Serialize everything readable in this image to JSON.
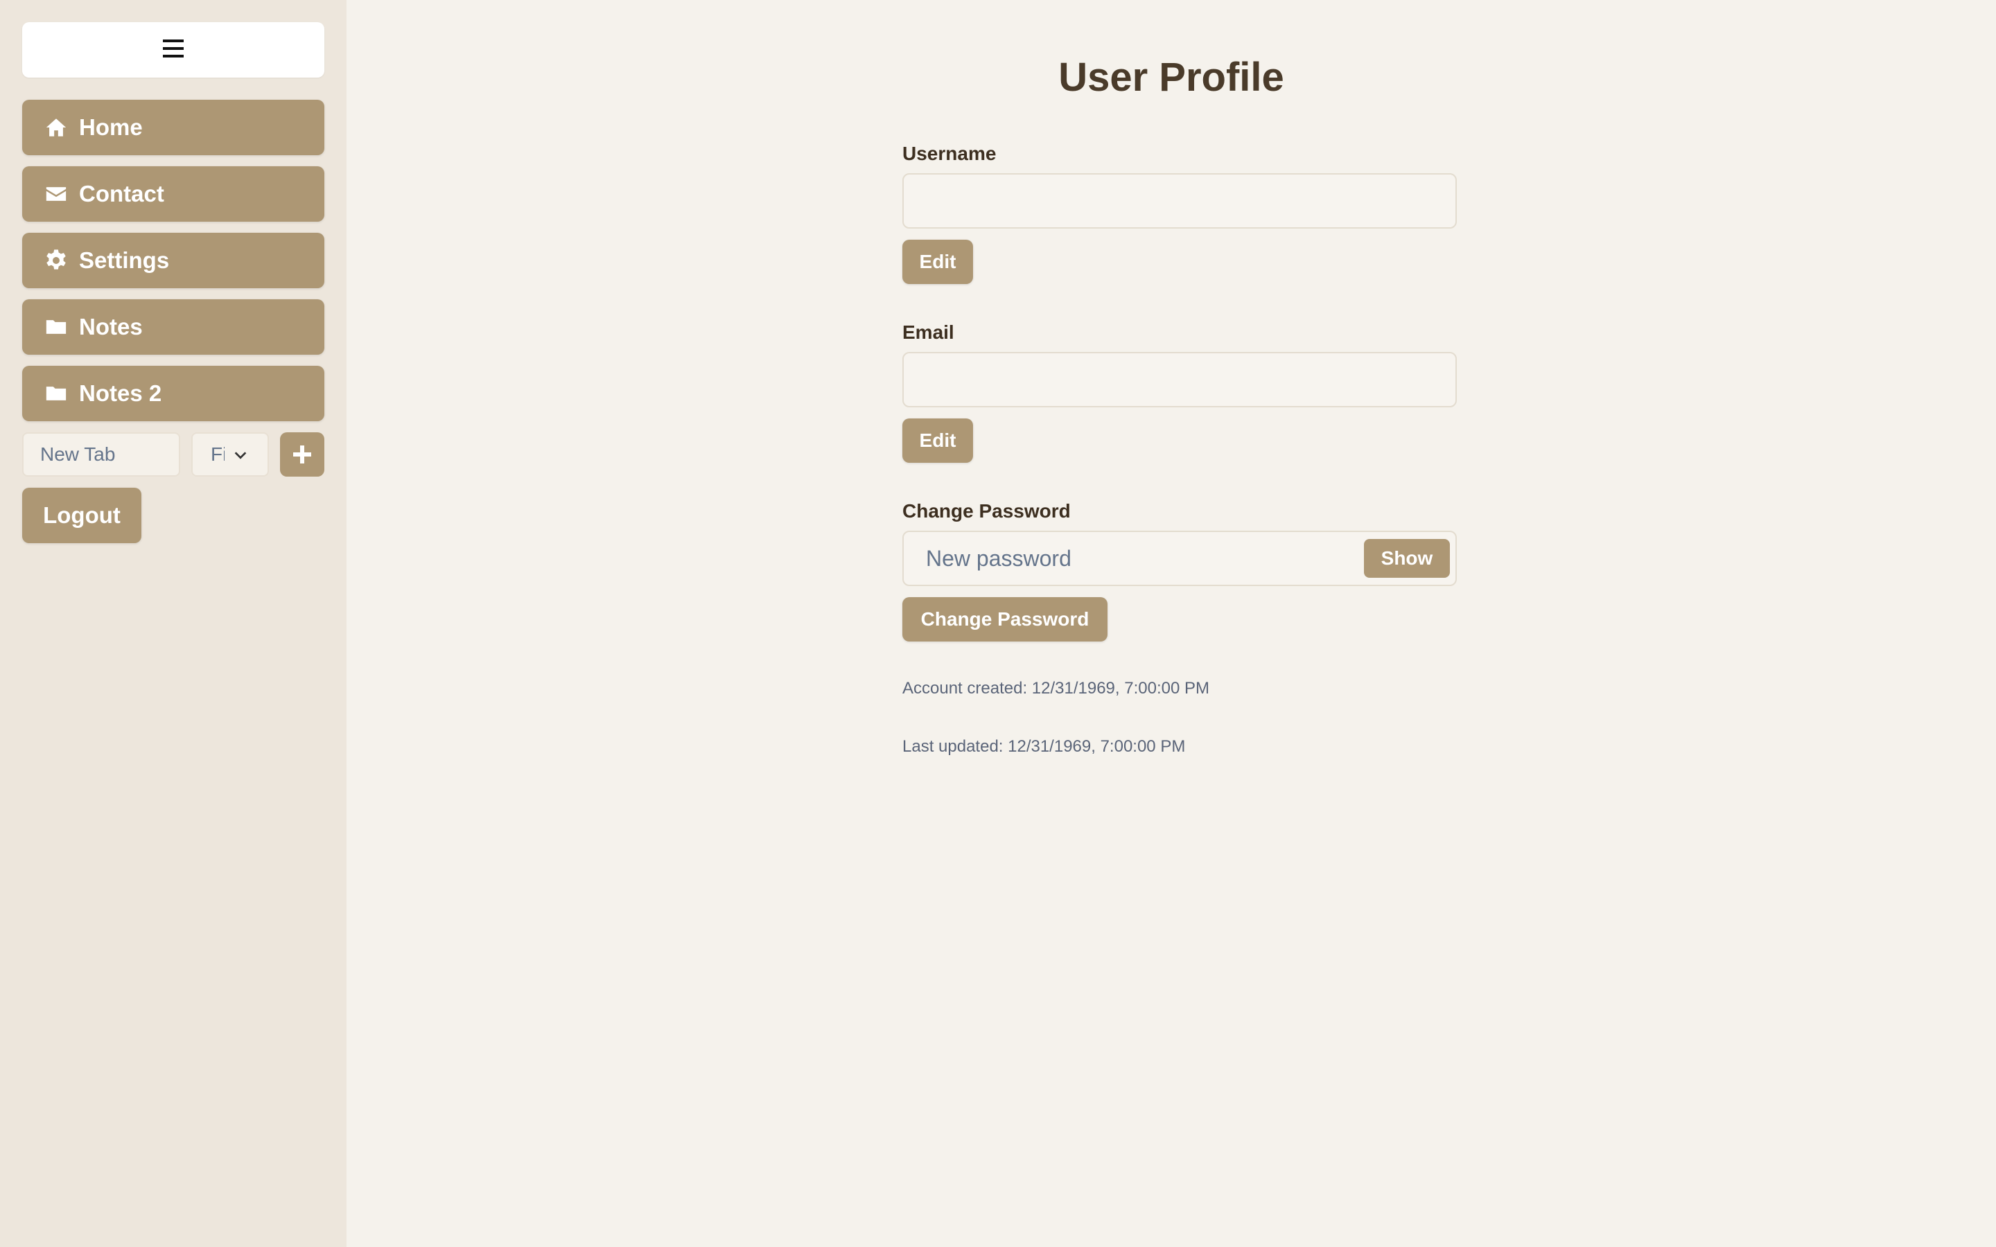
{
  "sidebar": {
    "toggle_icon": "hamburger-icon",
    "items": [
      {
        "label": "Home",
        "icon": "home-icon"
      },
      {
        "label": "Contact",
        "icon": "envelope-icon"
      },
      {
        "label": "Settings",
        "icon": "gear-icon"
      },
      {
        "label": "Notes",
        "icon": "folder-icon"
      },
      {
        "label": "Notes 2",
        "icon": "folder-icon"
      }
    ],
    "new_tab": {
      "placeholder": "New Tab",
      "select_value": "Fi"
    },
    "add_icon": "plus-icon",
    "logout_label": "Logout"
  },
  "profile": {
    "title": "User Profile",
    "username": {
      "label": "Username",
      "value": "",
      "edit_label": "Edit"
    },
    "email": {
      "label": "Email",
      "value": "",
      "edit_label": "Edit"
    },
    "password": {
      "label": "Change Password",
      "placeholder": "New password",
      "show_label": "Show",
      "submit_label": "Change Password"
    },
    "account_created": "Account created: 12/31/1969, 7:00:00 PM",
    "last_updated": "Last updated: 12/31/1969, 7:00:00 PM"
  },
  "colors": {
    "accent": "#ad9774",
    "sidebar_bg": "#ede6dc",
    "page_bg": "#f5f2ec",
    "heading": "#4a3b2a"
  }
}
